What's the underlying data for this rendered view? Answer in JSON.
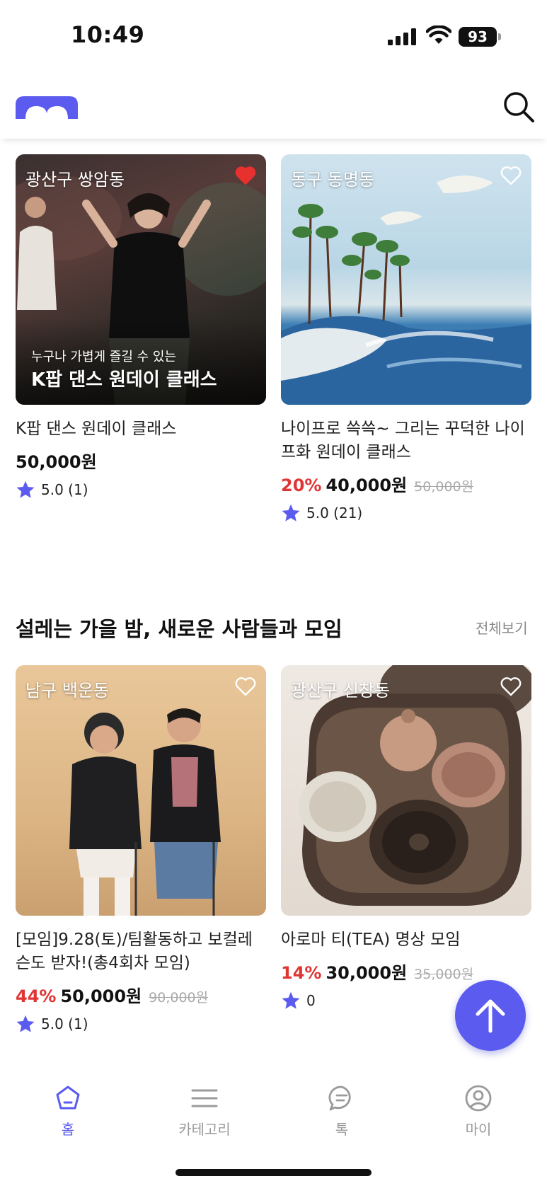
{
  "status": {
    "time": "10:49",
    "battery": "93"
  },
  "theme": {
    "accent": "#5b5bef",
    "discount": "#e03535"
  },
  "featured": [
    {
      "location": "광산구 쌍암동",
      "liked": true,
      "overlay_subtitle": "누구나 가볍게 즐길 수 있는",
      "overlay_title": "K팝 댄스 원데이 클래스",
      "title": "K팝 댄스 원데이 클래스",
      "discount": "",
      "price": "50,000원",
      "original_price": "",
      "rating": "5.0 (1)"
    },
    {
      "location": "동구 동명동",
      "liked": false,
      "title": "나이프로 쓱쓱~ 그리는 꾸덕한 나이프화 원데이 클래스",
      "discount": "20%",
      "price": "40,000원",
      "original_price": "50,000원",
      "rating": "5.0 (21)"
    }
  ],
  "section": {
    "title": "설레는 가을 밤, 새로운 사람들과 모임",
    "see_all": "전체보기",
    "items": [
      {
        "location": "남구 백운동",
        "liked": false,
        "title": "[모임]9.28(토)/팀활동하고 보컬레슨도 받자!(총4회차 모임)",
        "discount": "44%",
        "price": "50,000원",
        "original_price": "90,000원",
        "rating": "5.0 (1)"
      },
      {
        "location": "광산구 신창동",
        "liked": false,
        "title": "아로마 티(TEA) 명상 모임",
        "discount": "14%",
        "price": "30,000원",
        "original_price": "35,000원",
        "rating": "0"
      }
    ]
  },
  "tabs": [
    {
      "label": "홈",
      "icon": "home-icon",
      "active": true
    },
    {
      "label": "카테고리",
      "icon": "menu-icon",
      "active": false
    },
    {
      "label": "톡",
      "icon": "chat-icon",
      "active": false
    },
    {
      "label": "마이",
      "icon": "profile-icon",
      "active": false
    }
  ]
}
